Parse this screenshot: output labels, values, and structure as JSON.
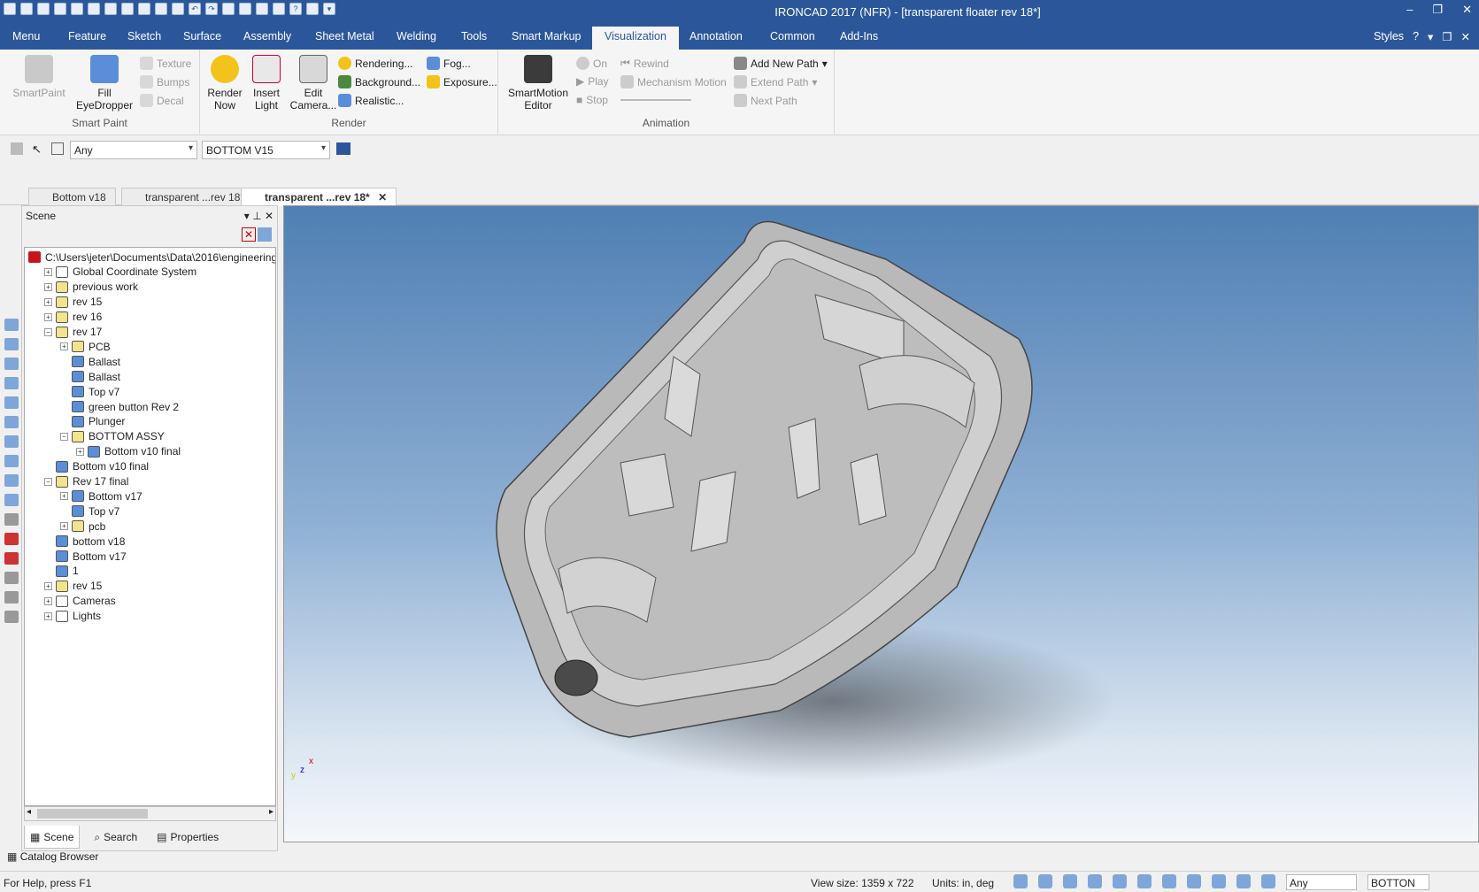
{
  "title": "IRONCAD 2017 (NFR) - [transparent floater rev 18*]",
  "ribbon_tabs": [
    "Menu",
    "Feature",
    "Sketch",
    "Surface",
    "Assembly",
    "Sheet Metal",
    "Welding",
    "Tools",
    "Smart Markup",
    "Visualization",
    "Annotation",
    "Common",
    "Add-Ins"
  ],
  "styles_label": "Styles",
  "groups": {
    "smart_paint": {
      "label": "Smart Paint",
      "smartpaint": "SmartPaint",
      "fill1": "Fill",
      "fill2": "EyeDropper",
      "texture": "Texture",
      "bumps": "Bumps",
      "decal": "Decal"
    },
    "render": {
      "label": "Render",
      "render_now1": "Render",
      "render_now2": "Now",
      "insert_light1": "Insert",
      "insert_light2": "Light",
      "edit_camera1": "Edit",
      "edit_camera2": "Camera...",
      "rendering": "Rendering...",
      "background": "Background...",
      "realistic": "Realistic...",
      "fog": "Fog...",
      "exposure": "Exposure..."
    },
    "animation": {
      "label": "Animation",
      "editor1": "SmartMotion",
      "editor2": "Editor",
      "on": "On",
      "play": "Play",
      "stop": "Stop",
      "rewind": "Rewind",
      "mechanism": "Mechanism Motion",
      "add_path": "Add New Path",
      "extend_path": "Extend Path",
      "next_path": "Next Path"
    }
  },
  "selection": {
    "filter": "Any",
    "view": "BOTTOM V15"
  },
  "doc_tabs": [
    "Bottom v18",
    "transparent ...rev 18*",
    "transparent ...rev 18*"
  ],
  "panel": {
    "title": "Scene",
    "tabs": [
      "Scene",
      "Search",
      "Properties"
    ]
  },
  "tree": [
    {
      "label": "C:\\Users\\jeter\\Documents\\Data\\2016\\engineering",
      "level": 0,
      "exp": "",
      "icon": "root"
    },
    {
      "label": "Global Coordinate System",
      "level": 1,
      "exp": "+",
      "icon": "coord"
    },
    {
      "label": "previous work",
      "level": 1,
      "exp": "+",
      "icon": "asm"
    },
    {
      "label": "rev 15",
      "level": 1,
      "exp": "+",
      "icon": "asm"
    },
    {
      "label": "rev 16",
      "level": 1,
      "exp": "+",
      "icon": "asm"
    },
    {
      "label": "rev 17",
      "level": 1,
      "exp": "-",
      "icon": "asm"
    },
    {
      "label": "PCB",
      "level": 2,
      "exp": "+",
      "icon": "asm"
    },
    {
      "label": "Ballast",
      "level": 2,
      "exp": "",
      "icon": "part"
    },
    {
      "label": "Ballast",
      "level": 2,
      "exp": "",
      "icon": "part"
    },
    {
      "label": "Top v7",
      "level": 2,
      "exp": "",
      "icon": "part"
    },
    {
      "label": "green button Rev 2",
      "level": 2,
      "exp": "",
      "icon": "part"
    },
    {
      "label": "Plunger",
      "level": 2,
      "exp": "",
      "icon": "part"
    },
    {
      "label": "BOTTOM ASSY",
      "level": 2,
      "exp": "-",
      "icon": "asm"
    },
    {
      "label": "Bottom v10 final",
      "level": 3,
      "exp": "+",
      "icon": "part"
    },
    {
      "label": "Bottom v10 final",
      "level": 1,
      "exp": "",
      "icon": "part"
    },
    {
      "label": "Rev 17 final",
      "level": 1,
      "exp": "-",
      "icon": "asm"
    },
    {
      "label": "Bottom v17",
      "level": 2,
      "exp": "+",
      "icon": "part"
    },
    {
      "label": "Top v7",
      "level": 2,
      "exp": "",
      "icon": "part"
    },
    {
      "label": "pcb",
      "level": 2,
      "exp": "+",
      "icon": "asm"
    },
    {
      "label": "bottom v18",
      "level": 1,
      "exp": "",
      "icon": "part"
    },
    {
      "label": "Bottom v17",
      "level": 1,
      "exp": "",
      "icon": "part"
    },
    {
      "label": "1",
      "level": 1,
      "exp": "",
      "icon": "part"
    },
    {
      "label": "rev 15",
      "level": 1,
      "exp": "+",
      "icon": "asm"
    },
    {
      "label": "Cameras",
      "level": 1,
      "exp": "+",
      "icon": "camera"
    },
    {
      "label": "Lights",
      "level": 1,
      "exp": "+",
      "icon": "light"
    }
  ],
  "catalog": "Catalog Browser",
  "status": {
    "help": "For Help, press F1",
    "view_size": "View size: 1359 x  722",
    "units": "Units: in, deg",
    "filter": "Any",
    "view": "BOTTON"
  }
}
